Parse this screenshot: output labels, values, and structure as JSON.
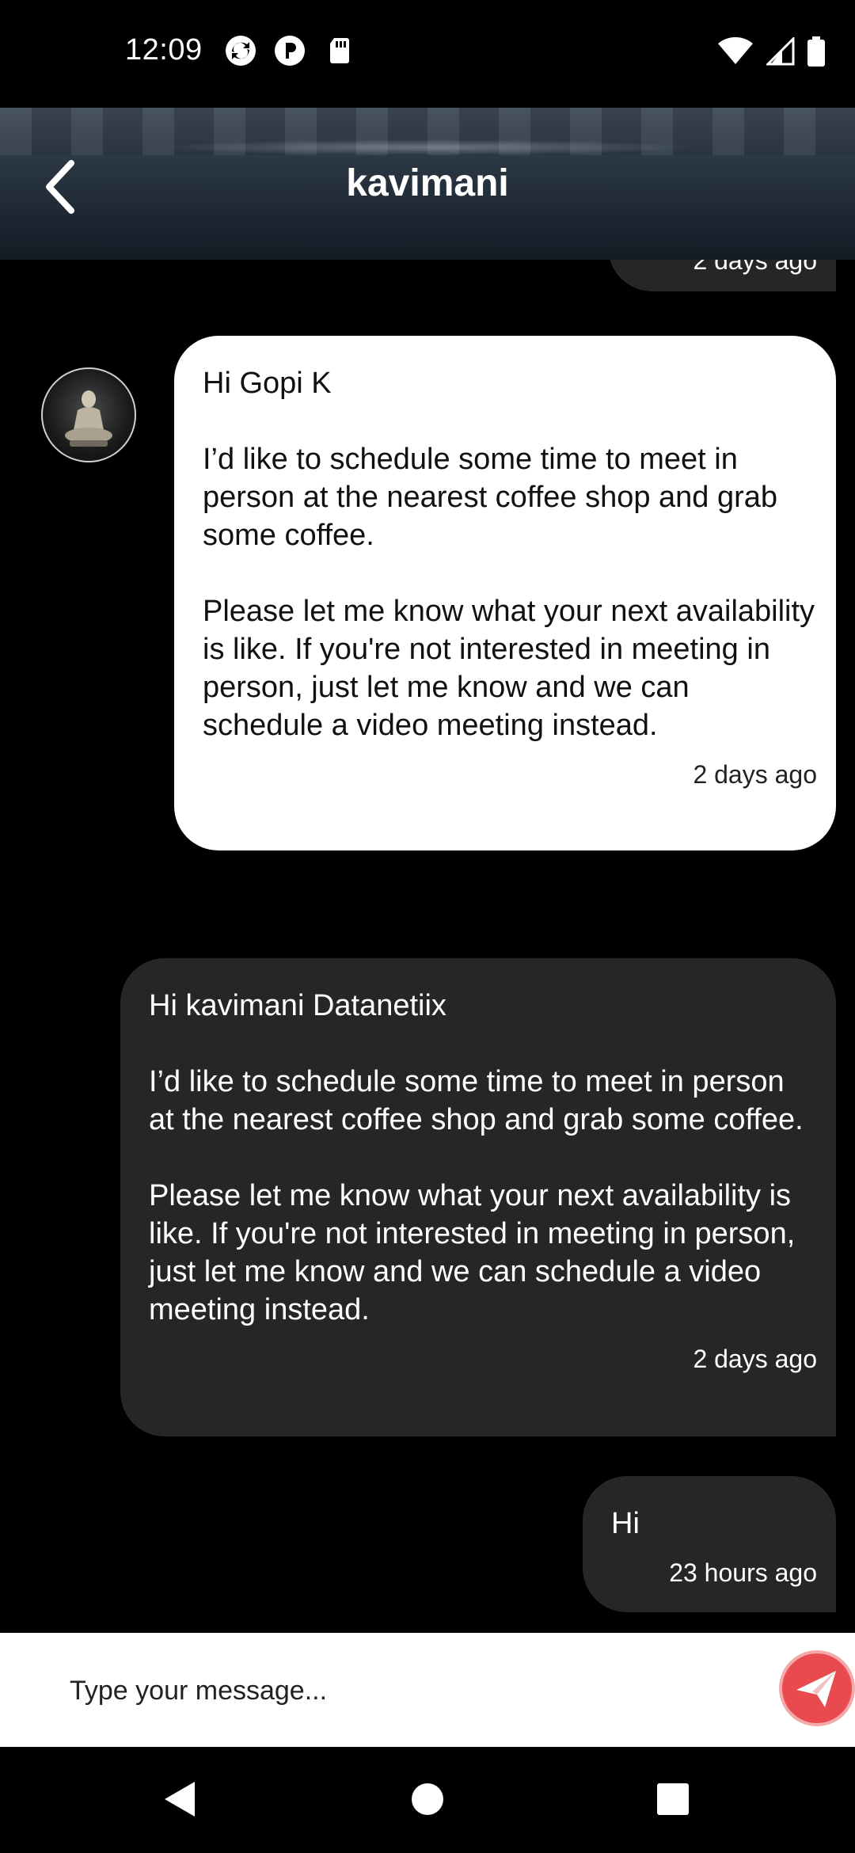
{
  "status": {
    "time": "12:09",
    "icons": [
      "sync-icon",
      "p-badge-icon",
      "sd-card-icon",
      "wifi-icon",
      "signal-icon",
      "battery-icon"
    ]
  },
  "header": {
    "title": "kavimani"
  },
  "messages": {
    "prev_time": "2 days ago",
    "incoming": {
      "text": "Hi Gopi K\n\nI’d like to schedule some time to meet in person at the nearest coffee shop and grab some coffee.\n\nPlease let me know what your next availability is like. If you're not interested in meeting in person, just let me know and we can schedule a video meeting instead.",
      "time": "2 days ago"
    },
    "outgoing1": {
      "text": "Hi kavimani Datanetiix\n\nI’d like to schedule some time to meet in person at the nearest coffee shop and grab some coffee.\n\nPlease let me know what your next availability is like. If you're not interested in meeting in person, just let me know and we can schedule a video meeting instead.",
      "time": "2 days ago"
    },
    "outgoing2": {
      "text": "Hi",
      "time": "23 hours ago"
    }
  },
  "composer": {
    "placeholder": "Type your message..."
  },
  "colors": {
    "accent": "#e84a50",
    "bubble_dark": "#262626",
    "bubble_light": "#ffffff"
  }
}
